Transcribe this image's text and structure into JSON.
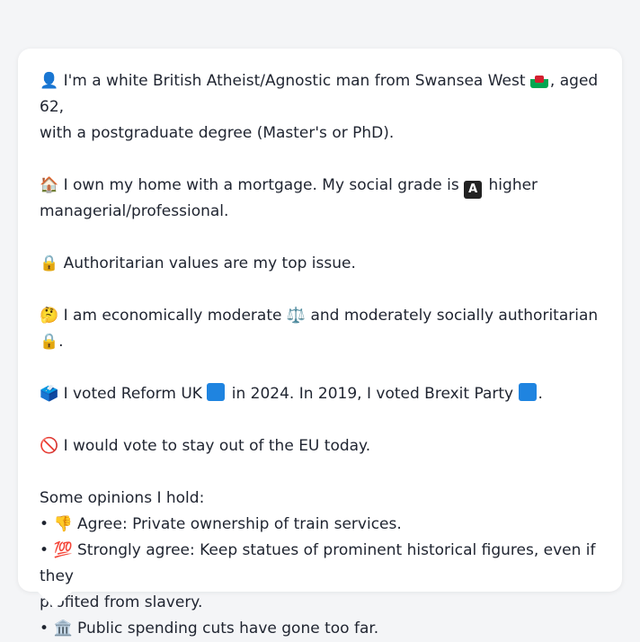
{
  "persona": {
    "line1": "I'm a white British Atheist/Agnostic man from Swansea West",
    "line1b": ", aged 62,",
    "line1c": "with a postgraduate degree (Master's or PhD).",
    "line2": "I own my home with a mortgage. My social grade is",
    "line2b": "higher",
    "line2c": "managerial/professional.",
    "grade_badge": "A",
    "line3": "Authoritarian values are my top issue.",
    "line4a": "I am economically moderate",
    "line4b": "and moderately socially authoritarian",
    "line4c": ".",
    "line5a": "I voted Reform UK",
    "line5b": "in 2024. In 2019, I voted Brexit Party",
    "line5c": ".",
    "line6": "I would vote to stay out of the EU today.",
    "opinions_heading": "Some opinions I hold:",
    "opinion1": "Agree: Private ownership of train services.",
    "opinion2a": "Strongly agree: Keep statues of prominent historical figures, even if they",
    "opinion2b": "profited from slavery.",
    "opinion3": "Public spending cuts have gone too far.",
    "bullet": "•"
  },
  "icons": {
    "person": "👤",
    "home": "🏠",
    "lock": "🔒",
    "thinking": "🤔",
    "scales": "⚖️",
    "ballot": "🗳️",
    "no": "🚫",
    "thumbs_down": "👎",
    "hundred": "💯",
    "bank": "🏛️"
  },
  "colors": {
    "party_blue": "#1f84e0",
    "text": "#1f2430",
    "background": "#f4f5f7"
  }
}
